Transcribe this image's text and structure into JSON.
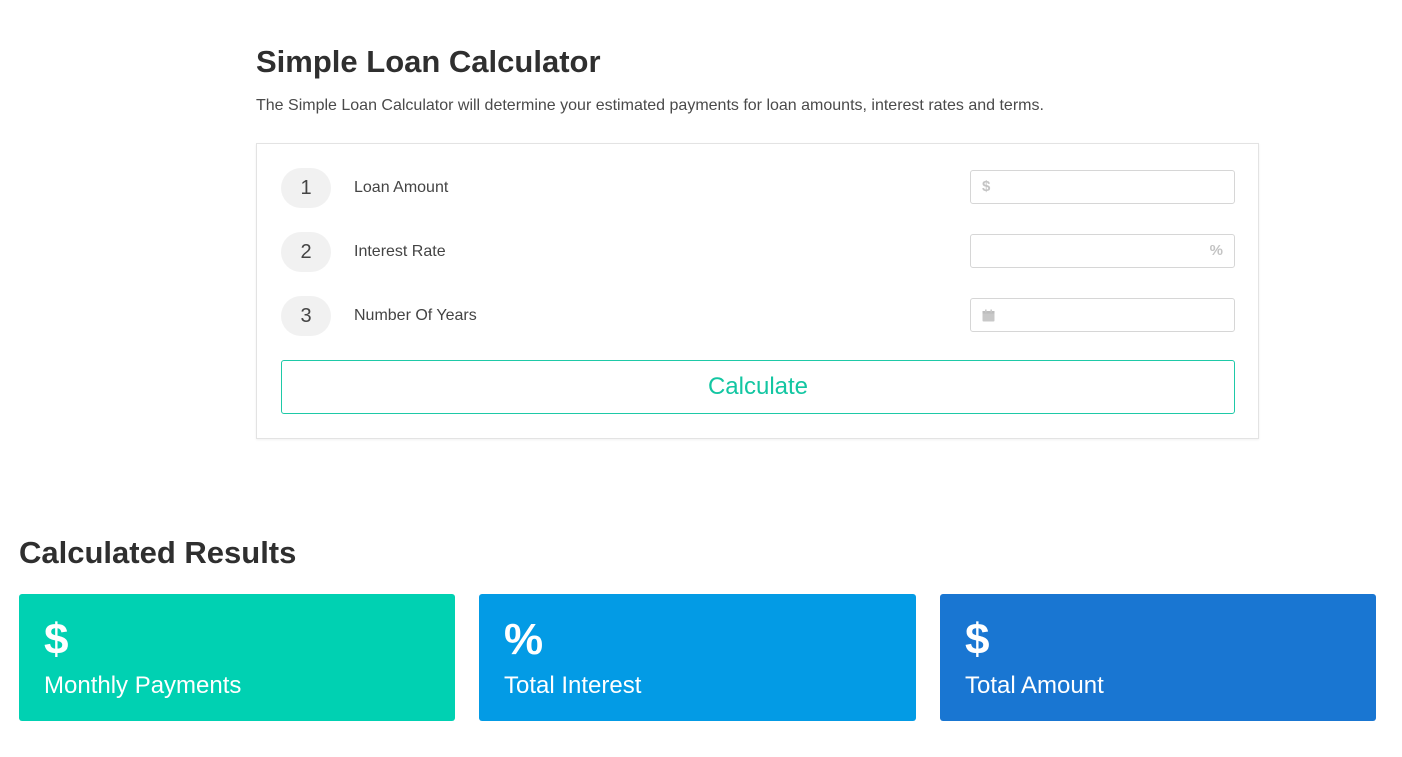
{
  "calculator": {
    "title": "Simple Loan Calculator",
    "description": "The Simple Loan Calculator will determine your estimated payments for loan amounts, interest rates and terms.",
    "rows": [
      {
        "number": "1",
        "label": "Loan Amount",
        "value": "",
        "placeholder": "",
        "icon": "dollar-icon",
        "icon_glyph": "$"
      },
      {
        "number": "2",
        "label": "Interest Rate",
        "value": "",
        "placeholder": "",
        "icon": "percent-icon",
        "icon_glyph": "%"
      },
      {
        "number": "3",
        "label": "Number Of Years",
        "value": "",
        "placeholder": "",
        "icon": "calendar-icon"
      }
    ],
    "button_label": "Calculate",
    "accent_color": "#1ec9a7"
  },
  "results": {
    "title": "Calculated Results",
    "cards": [
      {
        "symbol": "$",
        "label": "Monthly Payments",
        "color": "#00d1b2"
      },
      {
        "symbol": "%",
        "label": "Total Interest",
        "color": "#039be5"
      },
      {
        "symbol": "$",
        "label": "Total Amount",
        "color": "#1976d2"
      }
    ]
  }
}
